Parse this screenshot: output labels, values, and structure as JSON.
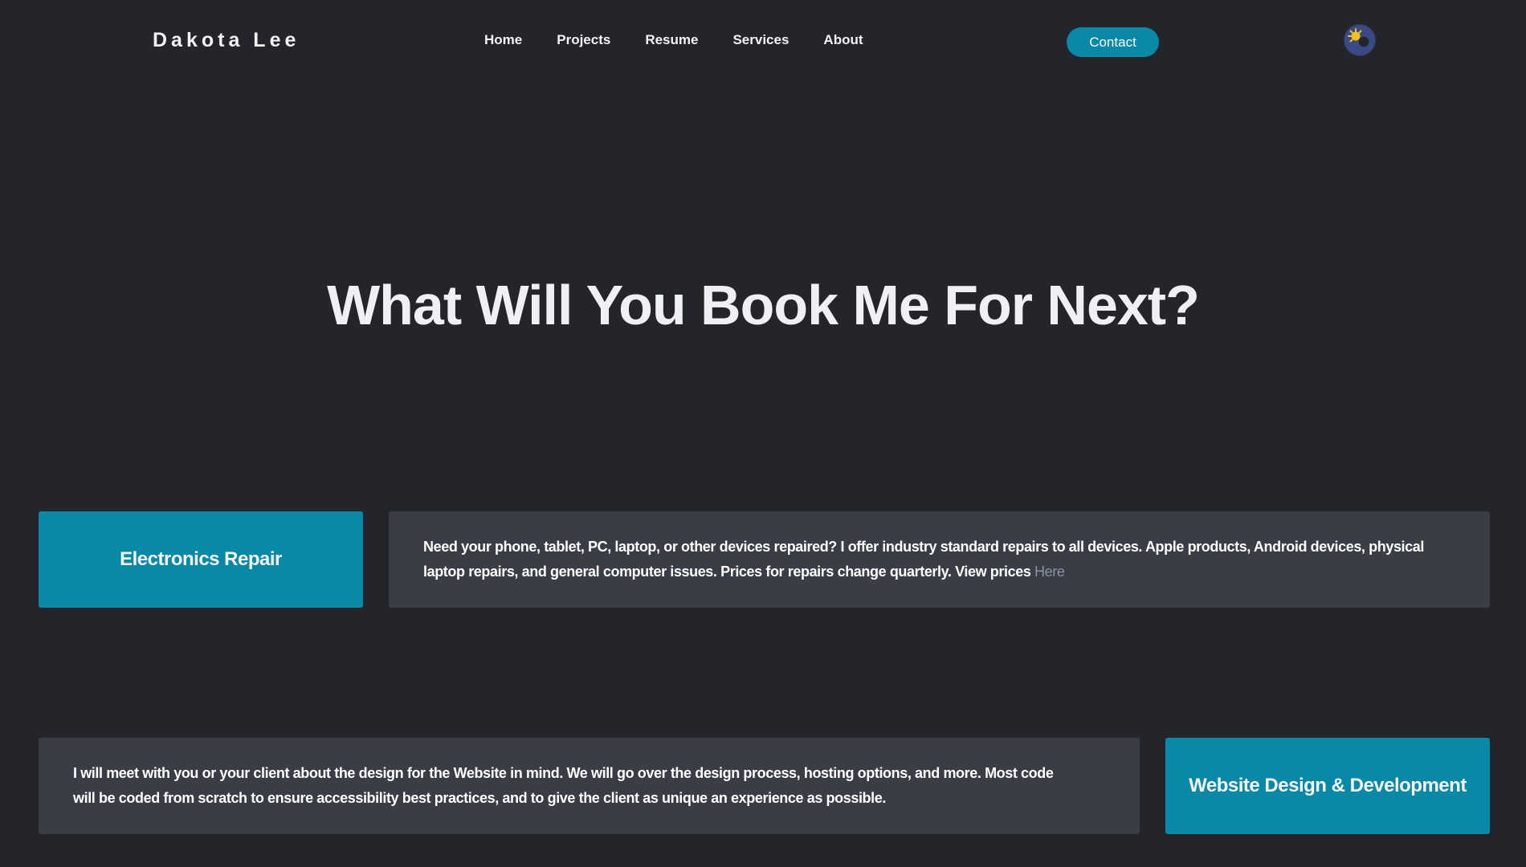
{
  "header": {
    "brand": "Dakota Lee",
    "nav": [
      {
        "label": "Home"
      },
      {
        "label": "Projects"
      },
      {
        "label": "Resume"
      },
      {
        "label": "Services"
      },
      {
        "label": "About"
      }
    ],
    "contact_label": "Contact",
    "theme_toggle_icon": "sun-moon-icon"
  },
  "hero": {
    "title": "What Will You Book Me For Next?"
  },
  "services": [
    {
      "title": "Electronics Repair",
      "description": "Need your phone, tablet, PC, laptop, or other devices repaired? I offer industry standard repairs to all devices. Apple products, Android devices, physical laptop repairs, and general computer issues. Prices for repairs change quarterly. View prices ",
      "link_label": "Here"
    },
    {
      "title": "Website Design & Development",
      "description": "I will meet with you or your client about the design for the Website in mind. We will go over the design process, hosting options, and more. Most code will be coded from scratch to ensure accessibility best practices, and to give the client as unique an experience as possible."
    }
  ],
  "colors": {
    "background": "#23252b",
    "accent": "#0a88a7",
    "card": "#3a3d45",
    "link": "#8a93a6"
  }
}
